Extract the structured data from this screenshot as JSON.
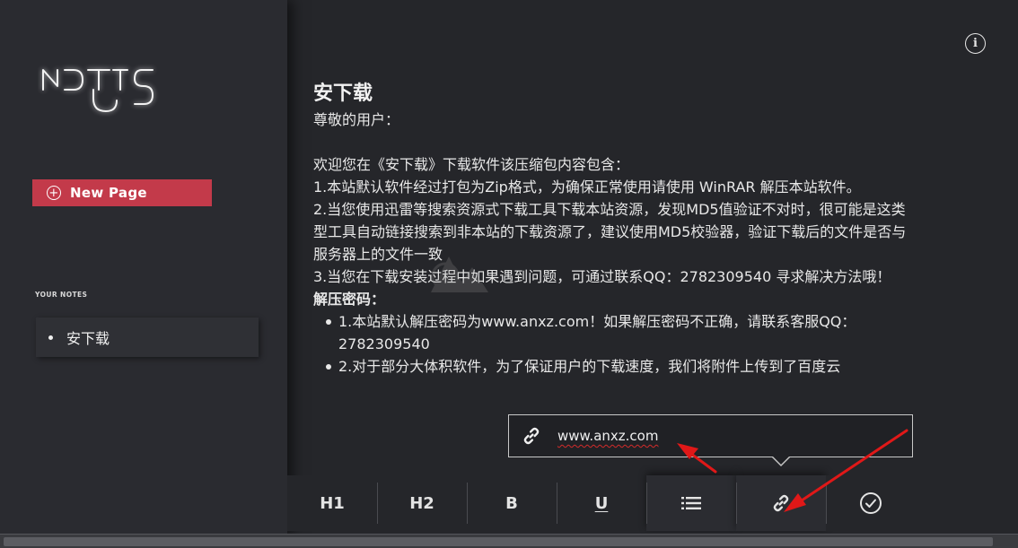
{
  "sidebar": {
    "new_page_label": "New Page",
    "section_title": "YOUR NOTES",
    "notes": [
      {
        "label": "安下载"
      }
    ]
  },
  "note": {
    "title": "安下载",
    "greeting": "尊敬的用户：",
    "intro": "欢迎您在《安下载》下载软件该压缩包内容包含：",
    "item1": "1.本站默认软件经过打包为Zip格式，为确保正常使用请使用 WinRAR 解压本站软件。",
    "item2": "2.当您使用迅雷等搜索资源式下载工具下载本站资源，发现MD5值验证不对时，很可能是这类型工具自动链接搜索到非本站的下载资源了，建议使用MD5校验器，验证下载后的文件是否与服务器上的文件一致",
    "item3": "3.当您在下载安装过程中如果遇到问题，可通过联系QQ：2782309540 寻求解决方法哦！",
    "password_heading": "解压密码：",
    "bullets": [
      "1.本站默认解压密码为www.anxz.com！如果解压密码不正确，请联系客服QQ：2782309540",
      "2.对于部分大体积软件，为了保证用户的下载速度，我们将附件上传到了百度云"
    ]
  },
  "link_popup": {
    "url": "www.anxz.com",
    "icon": "link-icon"
  },
  "toolbar": {
    "h1": "H1",
    "h2": "H2",
    "bold": "B",
    "underline": "U",
    "list_icon": "list-icon",
    "link_icon": "link-icon",
    "done_icon": "check-circle-icon"
  },
  "info_icon": "info-icon",
  "colors": {
    "accent": "#c33a4a",
    "background": "#25262a",
    "sidebar": "#2a2b30",
    "annotation_arrow": "#e01818"
  }
}
